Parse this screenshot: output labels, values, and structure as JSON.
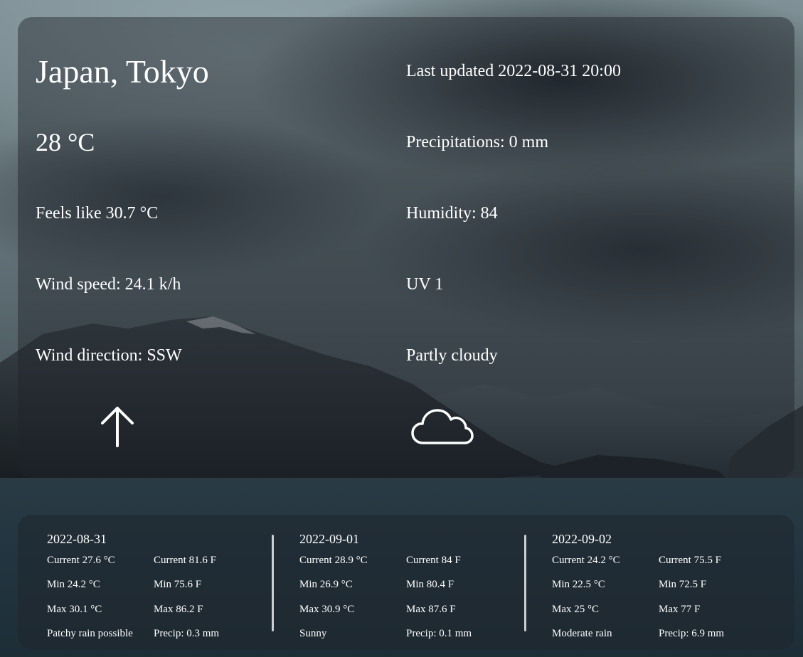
{
  "location": {
    "title": "Japan, Tokyo"
  },
  "current": {
    "temperature": "28 °C",
    "feels_like": "Feels like 30.7 °C",
    "wind_speed": "Wind speed: 24.1 k/h",
    "wind_direction": "Wind direction: SSW",
    "last_updated": "Last updated 2022-08-31 20:00",
    "precipitation": "Precipitations: 0 mm",
    "humidity": "Humidity: 84",
    "uv": "UV 1",
    "condition": "Partly cloudy",
    "wind_icon": "arrow-up-icon",
    "condition_icon": "cloud-icon"
  },
  "forecast": [
    {
      "date": "2022-08-31",
      "current_c": "Current 27.6 °C",
      "current_f": "Current 81.6 F",
      "min_c": "Min 24.2 °C",
      "min_f": "Min 75.6 F",
      "max_c": "Max 30.1 °C",
      "max_f": "Max 86.2 F",
      "condition": "Patchy rain possible",
      "precip": "Precip: 0.3 mm"
    },
    {
      "date": "2022-09-01",
      "current_c": "Current 28.9 °C",
      "current_f": "Current 84 F",
      "min_c": "Min 26.9 °C",
      "min_f": "Min 80.4 F",
      "max_c": "Max 30.9 °C",
      "max_f": "Max 87.6 F",
      "condition": "Sunny",
      "precip": "Precip: 0.1 mm"
    },
    {
      "date": "2022-09-02",
      "current_c": "Current 24.2 °C",
      "current_f": "Current 75.5 F",
      "min_c": "Min 22.5 °C",
      "min_f": "Min 72.5 F",
      "max_c": "Max 25 °C",
      "max_f": "Max 77 F",
      "condition": "Moderate rain",
      "precip": "Precip: 6.9 mm"
    }
  ]
}
